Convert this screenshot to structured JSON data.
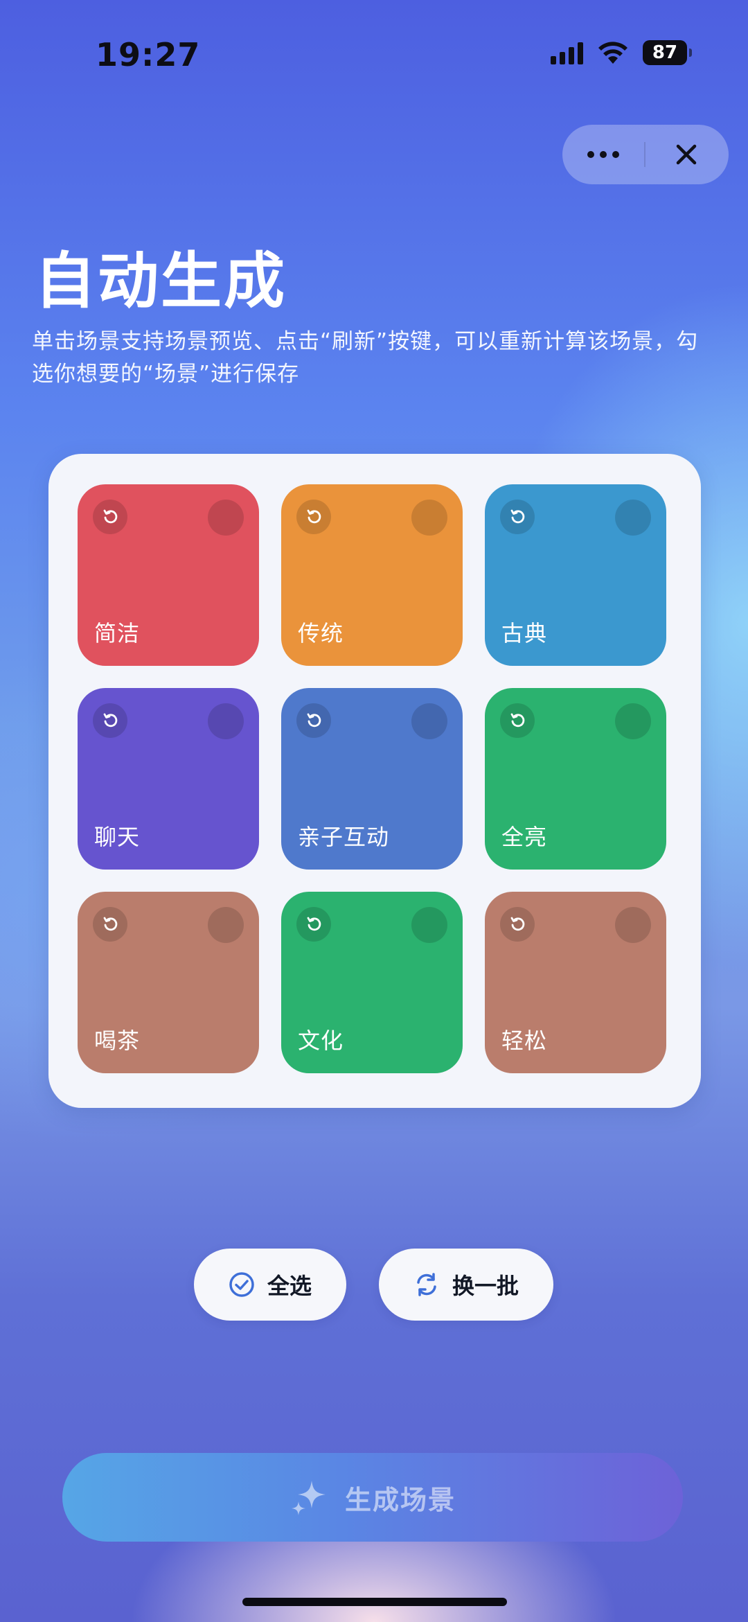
{
  "status": {
    "time": "19:27",
    "battery": "87"
  },
  "header": {
    "title": "自动生成",
    "description": "单击场景支持场景预览、点击“刷新”按键，可以重新计算该场景，勾选你想要的“场景”进行保存"
  },
  "scenes": [
    {
      "label": "简洁",
      "color": "#e0525e"
    },
    {
      "label": "传统",
      "color": "#ea933b"
    },
    {
      "label": "古典",
      "color": "#3b98cf"
    },
    {
      "label": "聊天",
      "color": "#6654cf"
    },
    {
      "label": "亲子互动",
      "color": "#4f79cc"
    },
    {
      "label": "全亮",
      "color": "#2bb26f"
    },
    {
      "label": "喝茶",
      "color": "#ba7d6c"
    },
    {
      "label": "文化",
      "color": "#2bb26f"
    },
    {
      "label": "轻松",
      "color": "#ba7d6c"
    }
  ],
  "actions": {
    "select_all": "全选",
    "refresh_batch": "换一批"
  },
  "generate_button": "生成场景",
  "icons": {
    "more": "more-dots-icon",
    "close": "close-icon",
    "refresh": "refresh-icon",
    "check": "check-circle-icon",
    "sparkle": "sparkle-icon",
    "swap": "swap-icon"
  }
}
